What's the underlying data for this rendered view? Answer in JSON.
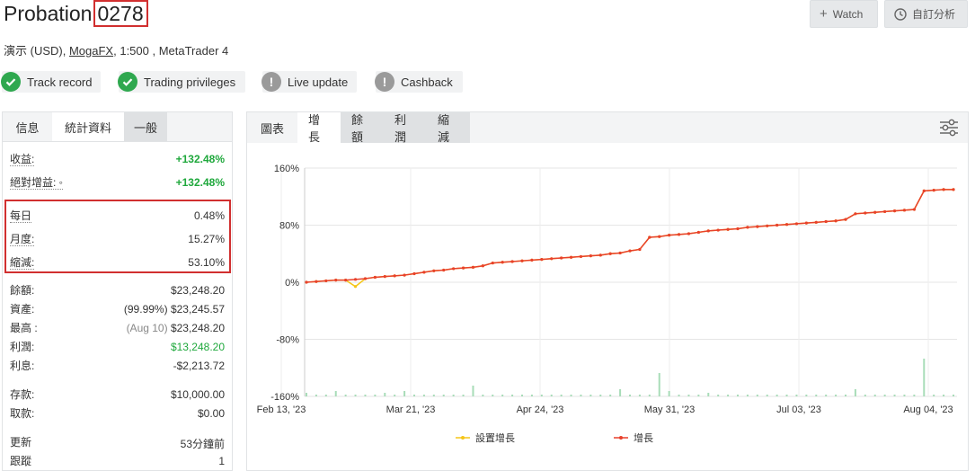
{
  "header": {
    "title_prefix": "Probation",
    "title_number": "0278",
    "sub_pre": "演示 (USD),",
    "broker": "MogaFX",
    "sub_post": ", 1:500 , MetaTrader 4",
    "watch_label": "Watch",
    "custom_label": "自訂分析"
  },
  "badges": [
    {
      "label": "Track record",
      "icon": "check-icon",
      "status": "ok"
    },
    {
      "label": "Trading privileges",
      "icon": "check-icon",
      "status": "ok"
    },
    {
      "label": "Live update",
      "icon": "exclamation-icon",
      "status": "warn"
    },
    {
      "label": "Cashback",
      "icon": "exclamation-icon",
      "status": "warn"
    }
  ],
  "left_tabs": [
    "信息",
    "統計資料",
    "一般"
  ],
  "stats": {
    "gain": {
      "label": "收益:",
      "value": "+132.48%"
    },
    "abs_gain": {
      "label": "絕對增益: ◦",
      "value": "+132.48%"
    },
    "daily": {
      "label": "每日",
      "value": "0.48%"
    },
    "monthly": {
      "label": "月度:",
      "value": "15.27%"
    },
    "drawdown": {
      "label": "縮減:",
      "value": "53.10%"
    },
    "balance": {
      "label": "餘額:",
      "value": "$23,248.20"
    },
    "equity": {
      "label": "資產:",
      "prefix": "(99.99%)",
      "value": "$23,245.57"
    },
    "highest": {
      "label": "最高 :",
      "prefix": "(Aug 10)",
      "value": "$23,248.20"
    },
    "profit": {
      "label": "利潤:",
      "value": "$13,248.20"
    },
    "interest": {
      "label": "利息:",
      "value": "-$2,213.72"
    },
    "deposits": {
      "label": "存款:",
      "value": "$10,000.00"
    },
    "withdrawals": {
      "label": "取款:",
      "value": "$0.00"
    },
    "updated": {
      "label": "更新",
      "value": "53分鐘前"
    },
    "tracking": {
      "label": "跟蹤",
      "value": "1"
    }
  },
  "right_tabs": [
    "圖表",
    "增長",
    "餘額",
    "利潤",
    "縮減"
  ],
  "colors": {
    "green": "#1fa83c",
    "red": "#d12f2f",
    "series_growth": "#e8412c",
    "series_equity": "#f5c518",
    "bars": "#a8dcb8"
  },
  "chart_data": {
    "type": "line",
    "y_ticks": [
      "160%",
      "80%",
      "0%",
      "-80%",
      "-160%"
    ],
    "ylim": [
      -160,
      160
    ],
    "x_ticks": [
      "Feb 13, '23",
      "Mar 21, '23",
      "Apr 24, '23",
      "May 31, '23",
      "Jul 03, '23",
      "Aug 04, '23"
    ],
    "series": [
      {
        "name": "設置增長",
        "values": [
          0,
          1,
          2,
          3,
          3,
          -6,
          5,
          7,
          8,
          9,
          10,
          12,
          14,
          16,
          17,
          19,
          20,
          21,
          23,
          27,
          28,
          29,
          30,
          31,
          32,
          33,
          34,
          35,
          36,
          37,
          38,
          40,
          41,
          44,
          46,
          63,
          64,
          66,
          67,
          68,
          70,
          72,
          73,
          74,
          75,
          77,
          78,
          79,
          80,
          81,
          82,
          83,
          84,
          85,
          86,
          88,
          96,
          97,
          98,
          99,
          100,
          101,
          102,
          128,
          129,
          130,
          130
        ]
      },
      {
        "name": "增長",
        "values": [
          0,
          1,
          2,
          3,
          3,
          4,
          5,
          7,
          8,
          9,
          10,
          12,
          14,
          16,
          17,
          19,
          20,
          21,
          23,
          27,
          28,
          29,
          30,
          31,
          32,
          33,
          34,
          35,
          36,
          37,
          38,
          40,
          41,
          44,
          46,
          63,
          64,
          66,
          67,
          68,
          70,
          72,
          73,
          74,
          75,
          77,
          78,
          79,
          80,
          81,
          82,
          83,
          84,
          85,
          86,
          88,
          96,
          97,
          98,
          99,
          100,
          101,
          102,
          128,
          129,
          130,
          130
        ]
      }
    ],
    "bars": [
      2,
      1,
      1,
      3,
      1,
      1,
      1,
      1,
      2,
      1,
      3,
      1,
      1,
      1,
      1,
      1,
      1,
      6,
      1,
      1,
      1,
      1,
      1,
      1,
      1,
      1,
      1,
      1,
      1,
      1,
      1,
      1,
      4,
      1,
      1,
      1,
      13,
      3,
      1,
      1,
      1,
      2,
      1,
      1,
      1,
      1,
      1,
      1,
      1,
      1,
      1,
      1,
      1,
      1,
      1,
      1,
      4,
      1,
      1,
      1,
      1,
      1,
      1,
      21,
      1,
      1,
      1
    ],
    "legend_position": "bottom",
    "grid": true
  }
}
